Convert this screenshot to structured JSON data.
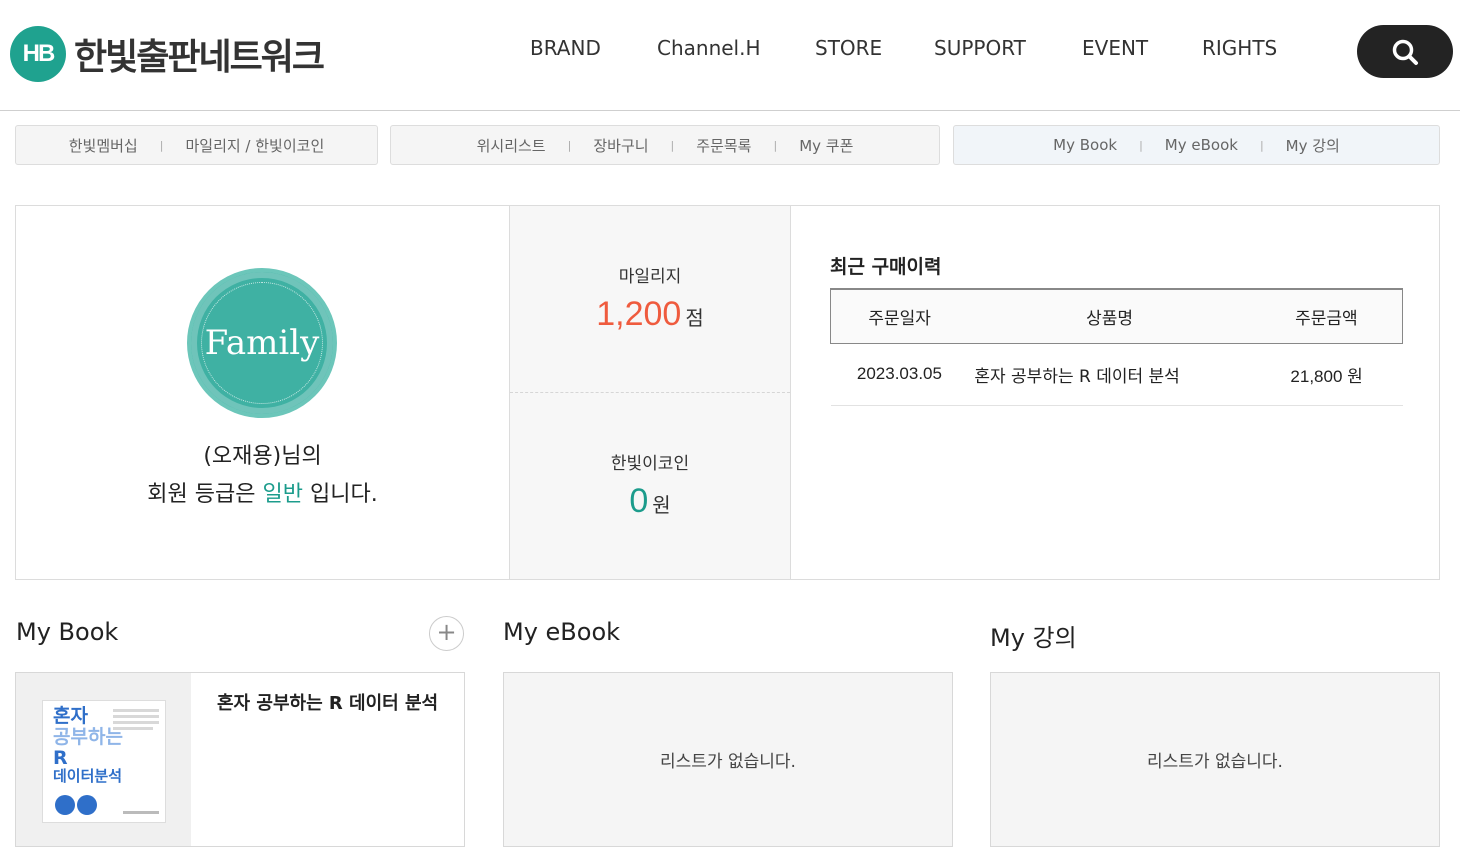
{
  "header": {
    "logo_mark": "HB",
    "logo_text": "한빛출판네트워크",
    "nav": [
      "BRAND",
      "Channel.H",
      "STORE",
      "SUPPORT",
      "EVENT",
      "RIGHTS"
    ],
    "search_icon": "search-icon"
  },
  "subnav": {
    "group1": [
      "한빛멤버십",
      "마일리지 / 한빛이코인"
    ],
    "group2": [
      "위시리스트",
      "장바구니",
      "주문목록",
      "My 쿠폰"
    ],
    "group3": [
      "My Book",
      "My eBook",
      "My 강의"
    ]
  },
  "profile": {
    "badge_text": "Family",
    "user_name_line": "(오재용)님의",
    "grade_prefix": "회원 등급은",
    "grade": "일반",
    "grade_suffix": "입니다."
  },
  "points": {
    "mileage_label": "마일리지",
    "mileage_value": "1,200",
    "mileage_unit": "점",
    "coin_label": "한빛이코인",
    "coin_value": "0",
    "coin_unit": "원"
  },
  "recent": {
    "title": "최근 구매이력",
    "columns": [
      "주문일자",
      "상품명",
      "주문금액"
    ],
    "rows": [
      {
        "date": "2023.03.05",
        "name": "혼자 공부하는 R 데이터 분석",
        "amount": "21,800 원"
      }
    ]
  },
  "my_book": {
    "title": "My Book",
    "plus": "+",
    "items": [
      {
        "title": "혼자 공부하는 R 데이터 분석",
        "cover_lines": [
          "혼자",
          "공부하는",
          "R",
          "데이터분석"
        ]
      }
    ]
  },
  "my_ebook": {
    "title": "My eBook",
    "empty": "리스트가 없습니다."
  },
  "my_lecture": {
    "title": "My 강의",
    "empty": "리스트가 없습니다."
  },
  "colors": {
    "brand": "#1fa28f",
    "mileage": "#ef5b3e",
    "coin": "#1c9c8c"
  }
}
